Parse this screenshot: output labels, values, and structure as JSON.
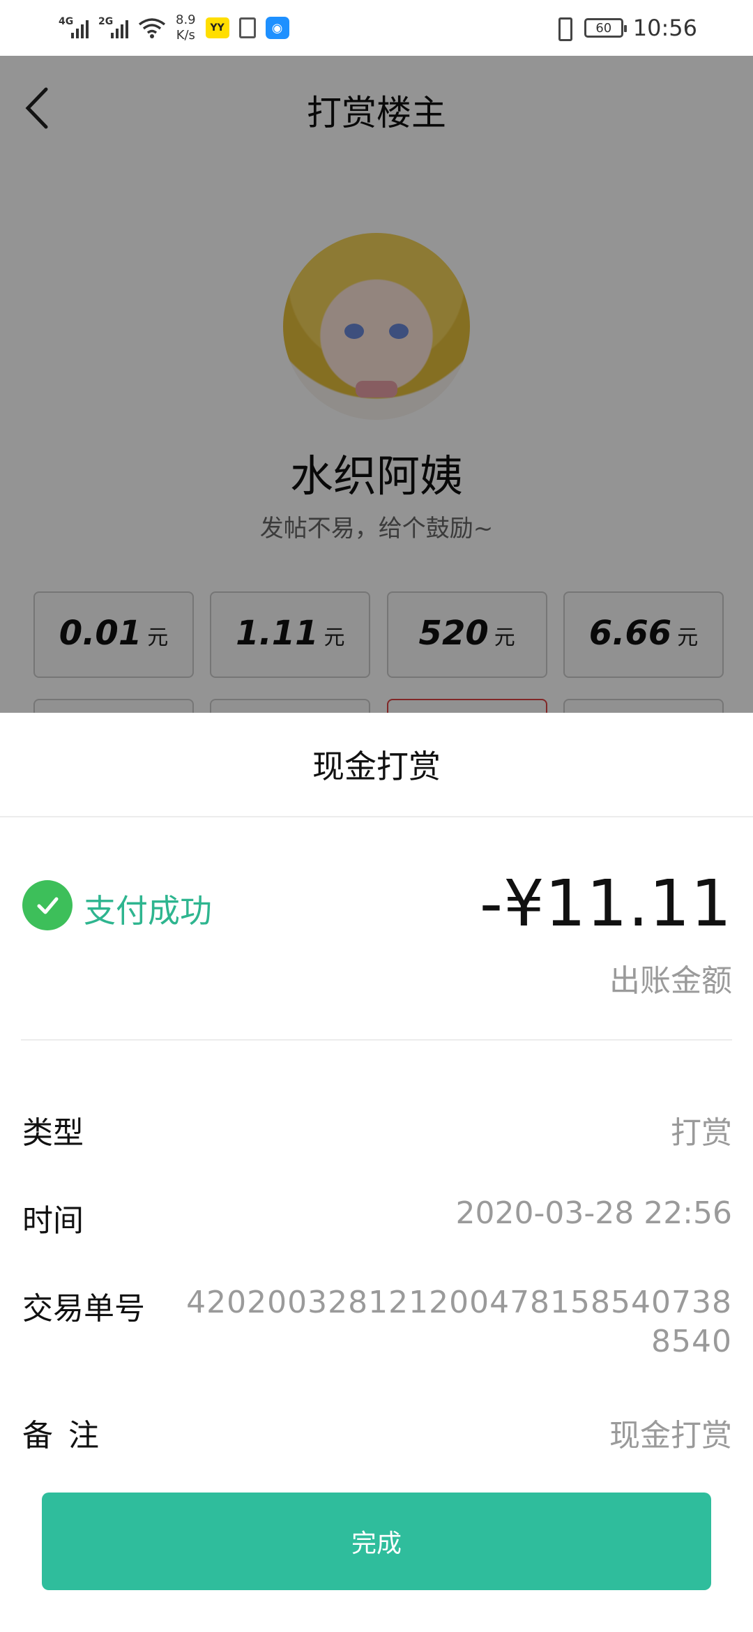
{
  "status_bar": {
    "network_1": "4G",
    "network_2": "2G",
    "speed_value": "8.9",
    "speed_unit": "K/s",
    "yy_icon": "YY",
    "battery": "60",
    "time": "10:56"
  },
  "background_page": {
    "title": "打赏楼主",
    "user_name": "水织阿姨",
    "subtitle": "发帖不易，给个鼓励~",
    "amounts": [
      {
        "value": "0.01",
        "unit": "元"
      },
      {
        "value": "1.11",
        "unit": "元"
      },
      {
        "value": "520",
        "unit": "元"
      },
      {
        "value": "6.66",
        "unit": "元"
      }
    ]
  },
  "sheet": {
    "title": "现金打赏",
    "status": "支付成功",
    "amount": "-¥11.11",
    "amount_caption": "出账金额",
    "rows": {
      "type": {
        "label": "类型",
        "value": "打赏"
      },
      "time": {
        "label": "时间",
        "value": "2020-03-28 22:56"
      },
      "order": {
        "label": "交易单号",
        "value": "4202003281212004781585407388540"
      },
      "note": {
        "label": "备注",
        "value": "现金打赏"
      }
    },
    "done_label": "完成"
  },
  "colors": {
    "accent": "#2fbd9c",
    "success": "#3dbf5a",
    "status_text": "#2eb58f"
  }
}
